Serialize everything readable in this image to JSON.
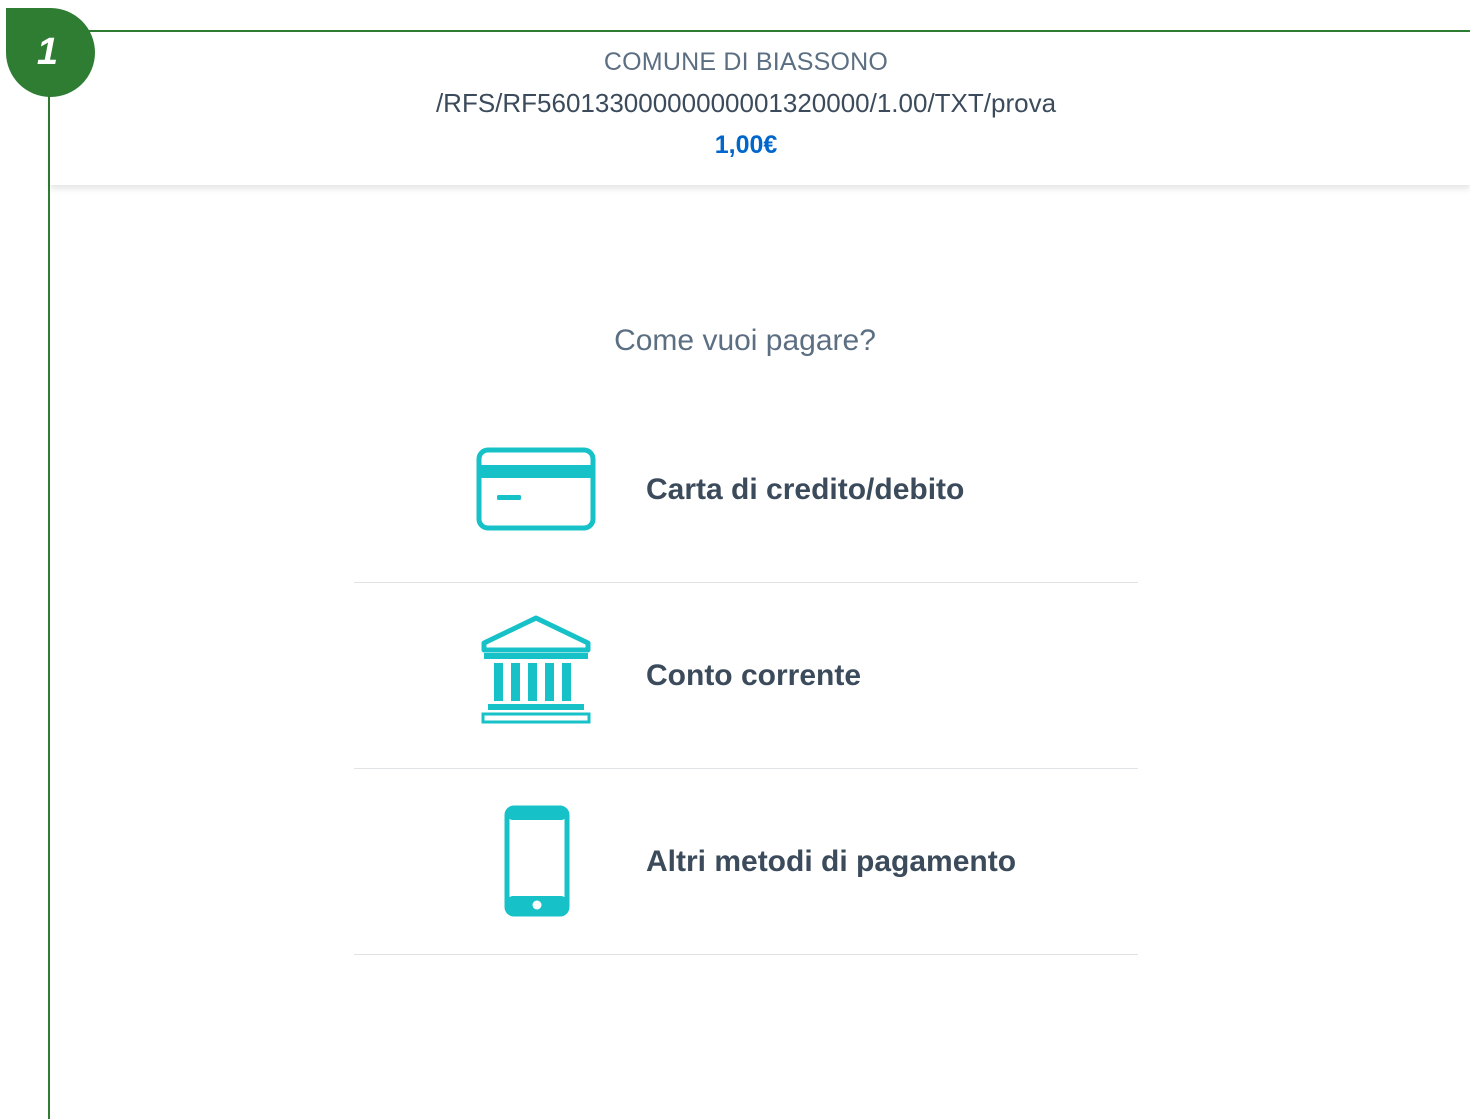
{
  "step": {
    "number": "1"
  },
  "header": {
    "entity": "COMUNE DI BIASSONO",
    "notice_code": "/RFS/RF56013300000000001320000/1.00/TXT/prova",
    "amount": "1,00€"
  },
  "question": "Come vuoi pagare?",
  "methods": [
    {
      "label": "Carta di credito/debito",
      "icon": "credit-card-icon"
    },
    {
      "label": "Conto corrente",
      "icon": "bank-icon"
    },
    {
      "label": "Altri metodi di pagamento",
      "icon": "smartphone-icon"
    }
  ],
  "colors": {
    "annotation_green": "#2e7d32",
    "icon_teal": "#17c1c8",
    "amount_blue": "#0066cc",
    "text_gray": "#5c6f82",
    "text_dark": "#3b4b5b"
  }
}
